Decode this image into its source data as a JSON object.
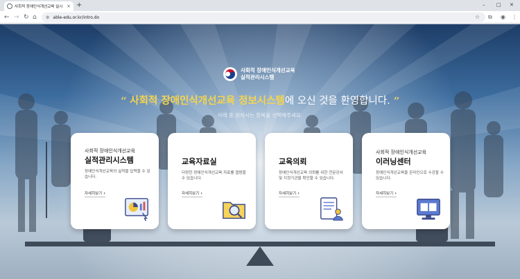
{
  "browser": {
    "tab_title": "사회적 장애인식개선교육 실시",
    "tab_close": "×",
    "new_tab": "+",
    "url": "able-edu.or.kr/intro.do",
    "window_controls": [
      "–",
      "□",
      "✕"
    ]
  },
  "header": {
    "logo_line1": "사회적 장애인식개선교육",
    "logo_line2": "실적관리시스템"
  },
  "hero": {
    "open_quote": "“",
    "highlight": "사회적 장애인식개선교육 정보시스템",
    "rest": "에 오신 것을 환영합니다.",
    "close_quote": "”",
    "subtitle": "아래 중 원하시는 항목을 선택해주세요."
  },
  "cards": [
    {
      "small": "사회적 장애인식개선교육",
      "title": "실적관리시스템",
      "desc": "장애인식개선교육의 실적을 입력할 수 있습니다.",
      "more": "자세히보기"
    },
    {
      "small": "",
      "title": "교육자료실",
      "desc": "다양한 장애인식개선교육 자료를 열람할 수 있습니다.",
      "more": "자세히보기"
    },
    {
      "small": "",
      "title": "교육의뢰",
      "desc": "장애인식개선교육 의뢰를 위한 전문강사 및 지정기관을 확인할 수 있습니다.",
      "more": "자세히보기"
    },
    {
      "small": "사회적 장애인식개선교육",
      "title": "이러닝센터",
      "desc": "장애인식개선교육을 온라인으로 수강할 수 있습니다.",
      "more": "자세히보기"
    }
  ],
  "colors": {
    "highlight": "#f7d54a",
    "card_bg": "#ffffff",
    "sky_top": "#1d3d67",
    "seesaw": "#3f4a58"
  },
  "icons": [
    "back-icon",
    "forward-icon",
    "reload-icon",
    "home-icon",
    "site-info-icon",
    "bookmark-star-icon",
    "extensions-icon",
    "profile-icon",
    "menu-icon"
  ]
}
